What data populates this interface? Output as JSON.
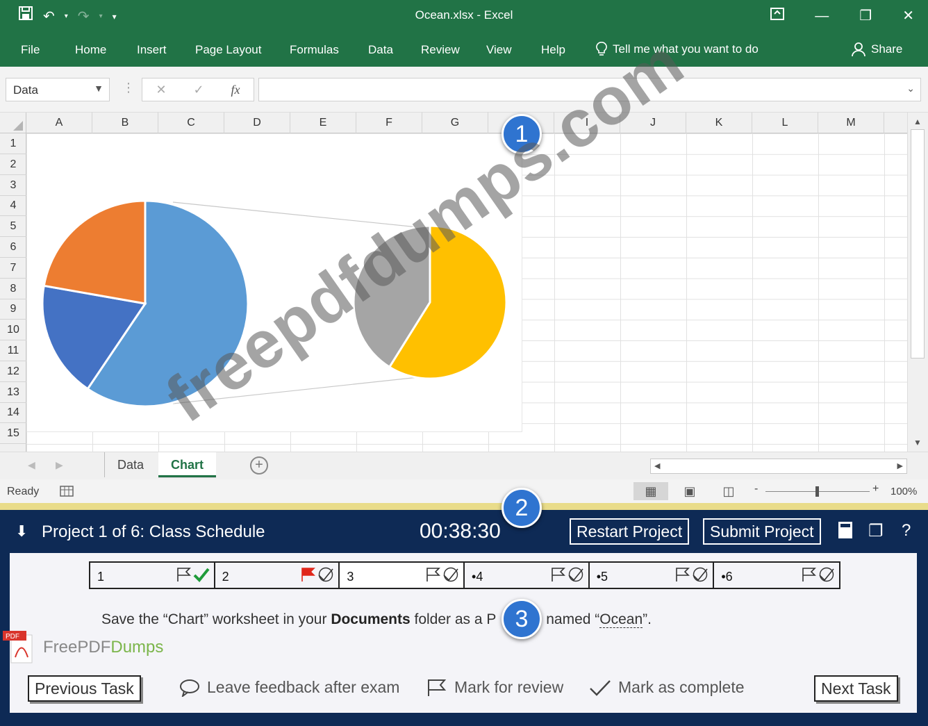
{
  "window": {
    "title": "Ocean.xlsx  -  Excel",
    "controls": [
      "ribbon-display-icon",
      "minimize-icon",
      "restore-icon",
      "close-icon"
    ]
  },
  "ribbon": {
    "tabs": [
      "File",
      "Home",
      "Insert",
      "Page Layout",
      "Formulas",
      "Data",
      "Review",
      "View",
      "Help"
    ],
    "tell_me": "Tell me what you want to do",
    "share": "Share"
  },
  "formula_bar": {
    "name_box": "Data",
    "cancel": "✕",
    "enter": "✓",
    "fx": "fx",
    "value": ""
  },
  "grid": {
    "columns": [
      "A",
      "B",
      "C",
      "D",
      "E",
      "F",
      "G",
      "H",
      "I",
      "J",
      "K",
      "L",
      "M"
    ],
    "rows": [
      "1",
      "2",
      "3",
      "4",
      "5",
      "6",
      "7",
      "8",
      "9",
      "10",
      "11",
      "12",
      "13",
      "14",
      "15"
    ]
  },
  "chart": {
    "type": "pie-of-pie",
    "main_pie_colors": [
      "#5b9bd5",
      "#4472c4",
      "#ed7d31"
    ],
    "secondary_pie_colors": [
      "#ffc000",
      "#a5a5a5"
    ]
  },
  "sheet_tabs": {
    "tabs": [
      "Data",
      "Chart"
    ],
    "active": "Chart",
    "add": "+"
  },
  "status_bar": {
    "ready": "Ready",
    "zoom": "100%",
    "zoom_minus": "-",
    "zoom_plus": "+"
  },
  "exam": {
    "project": "Project 1 of 6: Class Schedule",
    "timer": "00:38:30",
    "restart": "Restart Project",
    "submit": "Submit Project",
    "help": "?",
    "tasks": [
      {
        "label": "1",
        "flagged": false,
        "complete": true
      },
      {
        "label": "2",
        "flagged": true,
        "complete": false
      },
      {
        "label": "3",
        "flagged": false,
        "complete": false
      },
      {
        "label": "•4",
        "flagged": false,
        "complete": false
      },
      {
        "label": "•5",
        "flagged": false,
        "complete": false
      },
      {
        "label": "•6",
        "flagged": false,
        "complete": false
      }
    ],
    "instruction_pre": "Save the “Chart” worksheet in your ",
    "instruction_bold": "Documents",
    "instruction_mid": " folder as a P",
    "instruction_post": " named “",
    "instruction_name": "Ocean",
    "instruction_end": "”.",
    "previous": "Previous Task",
    "feedback": "Leave feedback after exam",
    "review": "Mark for review",
    "complete": "Mark as complete",
    "next": "Next Task"
  },
  "callouts": [
    "1",
    "2",
    "3"
  ],
  "watermark": {
    "diagonal": "freepdfdumps.com",
    "logo_a": "FreePDF",
    "logo_b": "Dumps",
    "logo_badge": "PDF"
  }
}
